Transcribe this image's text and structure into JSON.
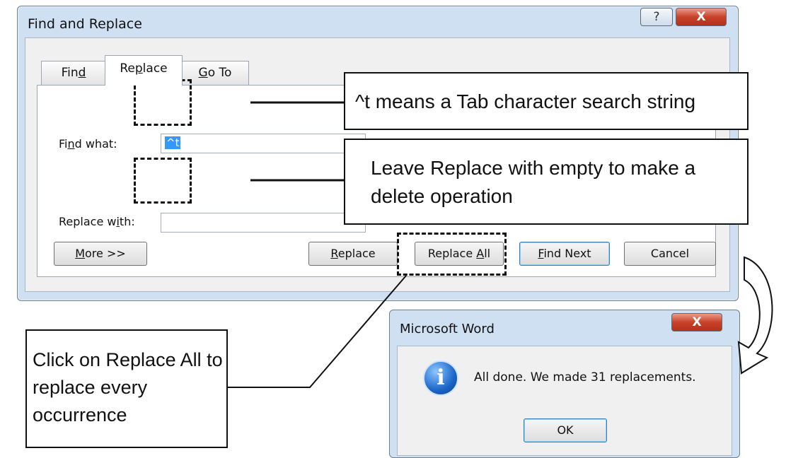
{
  "find_replace": {
    "title": "Find and Replace",
    "help_glyph": "?",
    "close_glyph": "X",
    "tabs": [
      {
        "pre": "Fin",
        "ul": "d",
        "post": ""
      },
      {
        "pre": "Re",
        "ul": "p",
        "post": "lace"
      },
      {
        "pre": "",
        "ul": "G",
        "post": "o To"
      }
    ],
    "find_label": {
      "pre": "Fi",
      "ul": "n",
      "post": "d what:"
    },
    "find_value": "^t",
    "replace_label": {
      "pre": "Replace w",
      "ul": "i",
      "post": "th:"
    },
    "replace_value": "",
    "buttons": {
      "more": {
        "pre": "",
        "ul": "M",
        "post": "ore >>"
      },
      "replace": {
        "pre": "",
        "ul": "R",
        "post": "eplace"
      },
      "replace_all": {
        "pre": "Replace ",
        "ul": "A",
        "post": "ll"
      },
      "find_next": {
        "pre": "",
        "ul": "F",
        "post": "ind Next"
      },
      "cancel": "Cancel"
    }
  },
  "callouts": {
    "tab_char": "^t means a Tab character search string",
    "empty_replace": "Leave Replace with empty to make a delete operation",
    "click_replace_all": "Click on Replace All to replace every occurrence"
  },
  "message_box": {
    "title": "Microsoft Word",
    "close_glyph": "X",
    "icon_glyph": "i",
    "message": "All done. We made 31 replacements.",
    "ok_label": "OK"
  }
}
